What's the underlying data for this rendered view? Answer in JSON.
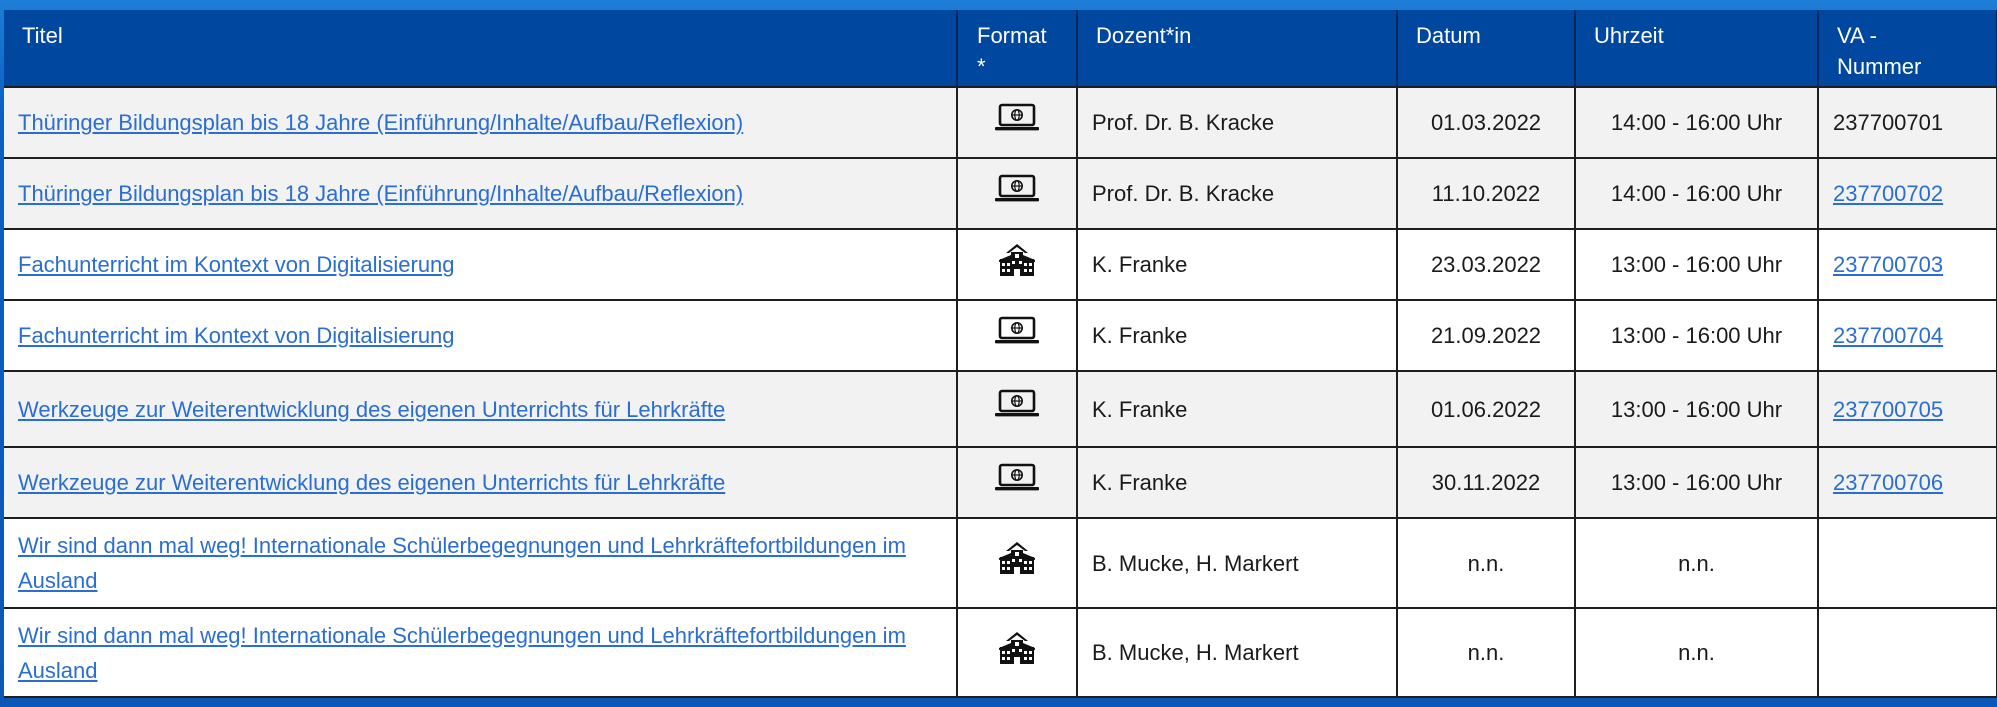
{
  "table": {
    "headers": {
      "title": "Titel",
      "format_line1": "Format",
      "format_line2": "*",
      "dozent": "Dozent*in",
      "datum": "Datum",
      "uhrzeit": "Uhrzeit",
      "va_line1": "VA -",
      "va_line2": "Nummer"
    },
    "rows": [
      {
        "title": "Thüringer Bildungsplan bis 18 Jahre (Einführung/Inhalte/Aufbau/Reflexion)",
        "format_icon": "laptop-globe-icon",
        "dozent": "Prof. Dr. B. Kracke",
        "datum": "01.03.2022",
        "uhrzeit": "14:00 - 16:00 Uhr",
        "va": "237700701",
        "va_is_link": false
      },
      {
        "title": "Thüringer Bildungsplan bis 18 Jahre (Einführung/Inhalte/Aufbau/Reflexion)",
        "format_icon": "laptop-globe-icon",
        "dozent": "Prof. Dr. B. Kracke",
        "datum": "11.10.2022",
        "uhrzeit": "14:00 - 16:00 Uhr",
        "va": "237700702",
        "va_is_link": true
      },
      {
        "title": "Fachunterricht im Kontext von Digitalisierung",
        "format_icon": "school-building-icon",
        "dozent": "K. Franke",
        "datum": "23.03.2022",
        "uhrzeit": "13:00 - 16:00 Uhr",
        "va": "237700703",
        "va_is_link": true
      },
      {
        "title": "Fachunterricht im Kontext von Digitalisierung",
        "format_icon": "laptop-globe-icon",
        "dozent": "K. Franke",
        "datum": "21.09.2022",
        "uhrzeit": "13:00 - 16:00 Uhr",
        "va": "237700704",
        "va_is_link": true
      },
      {
        "title": "Werkzeuge zur Weiterentwicklung des eigenen Unterrichts für Lehrkräfte",
        "format_icon": "laptop-globe-icon",
        "dozent": "K. Franke",
        "datum": "01.06.2022",
        "uhrzeit": "13:00 - 16:00 Uhr",
        "va": "237700705",
        "va_is_link": true
      },
      {
        "title": "Werkzeuge zur Weiterentwicklung des eigenen Unterrichts für Lehrkräfte",
        "format_icon": "laptop-globe-icon",
        "dozent": "K. Franke",
        "datum": "30.11.2022",
        "uhrzeit": "13:00 - 16:00 Uhr",
        "va": "237700706",
        "va_is_link": true
      },
      {
        "title": "Wir sind dann mal weg! Internationale Schülerbegegnungen und Lehrkräftefortbildungen im Ausland",
        "format_icon": "school-building-icon",
        "dozent": "B. Mucke, H. Markert",
        "datum": "n.n.",
        "uhrzeit": "n.n.",
        "va": "",
        "va_is_link": false
      },
      {
        "title": "Wir sind dann mal weg! Internationale Schülerbegegnungen und Lehrkräftefortbildungen im Ausland",
        "format_icon": "school-building-icon",
        "dozent": "B. Mucke, H. Markert",
        "datum": "n.n.",
        "uhrzeit": "n.n.",
        "va": "",
        "va_is_link": false
      }
    ]
  },
  "colors": {
    "header_bg": "#0047a0",
    "header_text": "#ffffff",
    "link": "#2a6ed2",
    "row_shade": "#f2f2f2",
    "row_plain": "#ffffff"
  }
}
